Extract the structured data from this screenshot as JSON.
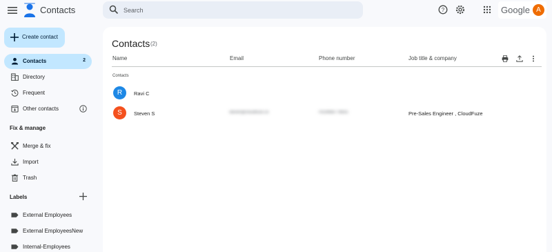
{
  "app": {
    "title": "Contacts"
  },
  "search": {
    "placeholder": "Search"
  },
  "account": {
    "brand": "Google",
    "avatar_letter": "A",
    "avatar_color": "#ef6c00"
  },
  "sidebar": {
    "create_label": "Create contact",
    "items": [
      {
        "label": "Contacts",
        "count": "2",
        "icon": "person-icon",
        "active": true
      },
      {
        "label": "Directory",
        "icon": "directory-icon"
      },
      {
        "label": "Frequent",
        "icon": "history-icon"
      },
      {
        "label": "Other contacts",
        "icon": "other-contacts-icon"
      }
    ],
    "fix_section": "Fix & manage",
    "fix_items": [
      {
        "label": "Merge & fix",
        "icon": "merge-fix-icon"
      },
      {
        "label": "Import",
        "icon": "import-icon"
      },
      {
        "label": "Trash",
        "icon": "trash-icon"
      }
    ],
    "labels_section": "Labels",
    "labels": [
      {
        "label": "External Employees",
        "icon": "label-icon"
      },
      {
        "label": "External EmployeesNew",
        "icon": "label-icon"
      },
      {
        "label": "Internal-Employees",
        "icon": "label-icon"
      }
    ]
  },
  "main": {
    "title": "Contacts",
    "count": "(2)",
    "columns": [
      "Name",
      "Email",
      "Phone number",
      "Job title & company"
    ],
    "group_label": "Contacts",
    "rows": [
      {
        "initial": "R",
        "color": "#1e88e5",
        "name": "Ravi C",
        "email": "",
        "phone": "",
        "job": ""
      },
      {
        "initial": "S",
        "color": "#f4511e",
        "name": "Steven S",
        "email": "steven@cloudfuze.co",
        "phone": "+919988776655",
        "job": "Pre-Sales Engineer , CloudFuze"
      }
    ]
  },
  "colors": {
    "accent": "#c2e7ff",
    "search_bg": "#e9eef6",
    "page_bg": "#f8f9fc"
  }
}
